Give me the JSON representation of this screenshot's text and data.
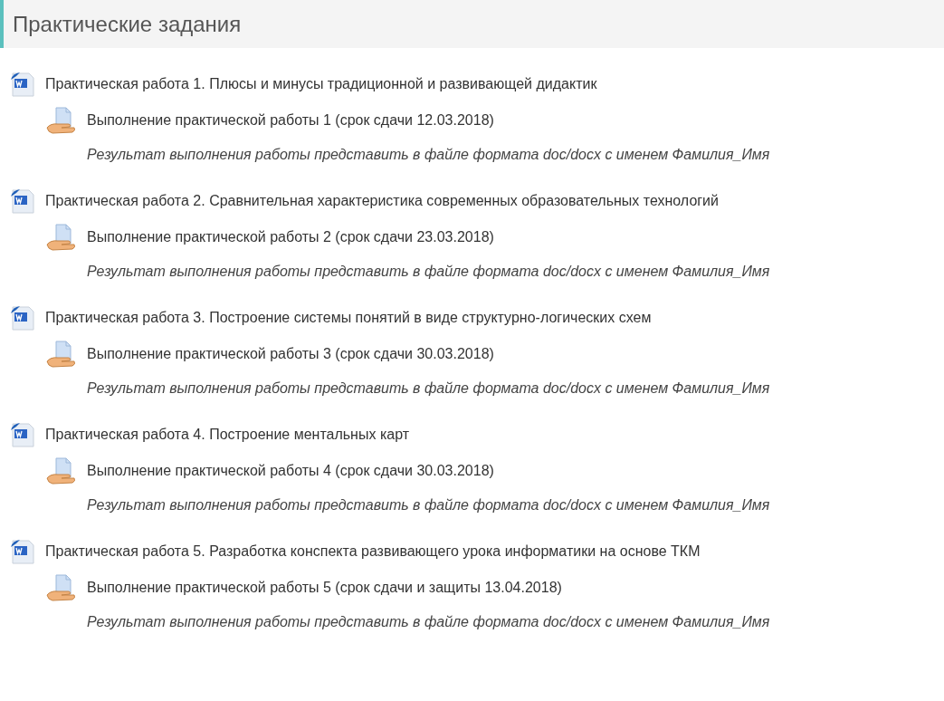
{
  "section": {
    "title": "Практические задания"
  },
  "items": [
    {
      "title": "Практическая работа 1. Плюсы и минусы традиционной и развивающей дидактик",
      "assignment": "Выполнение практической работы 1 (срок сдачи 12.03.2018)",
      "note": "Результат выполнения работы представить в файле формата doc/docx с именем Фамилия_Имя"
    },
    {
      "title": "Практическая работа 2. Сравнительная характеристика современных образовательных технологий",
      "assignment": "Выполнение практической работы 2 (срок сдачи 23.03.2018)",
      "note": "Результат выполнения работы представить в файле формата doc/docx с именем Фамилия_Имя"
    },
    {
      "title": "Практическая работа 3. Построение системы понятий в виде структурно-логических схем",
      "assignment": "Выполнение практической работы 3 (срок сдачи 30.03.2018)",
      "note": "Результат выполнения работы представить в файле формата doc/docx с именем Фамилия_Имя"
    },
    {
      "title": "Практическая работа 4. Построение ментальных карт",
      "assignment": "Выполнение практической работы 4 (срок сдачи 30.03.2018)",
      "note": "Результат выполнения работы представить в файле формата doc/docx с именем Фамилия_Имя"
    },
    {
      "title": "Практическая работа 5. Разработка конспекта развивающего урока информатики на основе ТКМ",
      "assignment": "Выполнение практической работы 5 (срок сдачи и защиты 13.04.2018)",
      "note": "Результат выполнения работы представить в файле формата doc/docx с именем Фамилия_Имя"
    }
  ]
}
